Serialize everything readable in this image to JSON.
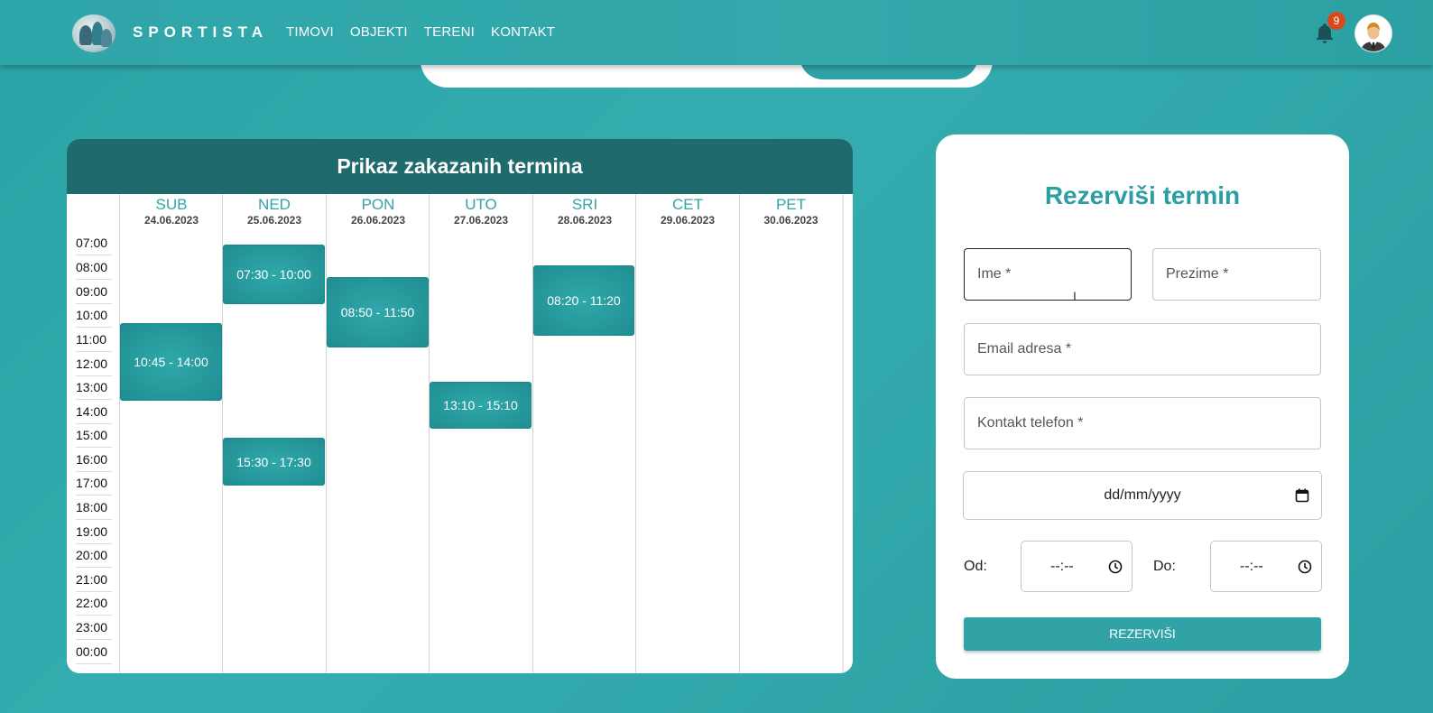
{
  "brand": {
    "name": "SPORTISTA"
  },
  "nav": {
    "items": [
      "TIMOVI",
      "OBJEKTI",
      "TERENI",
      "KONTAKT"
    ]
  },
  "notifications": {
    "count": "9"
  },
  "schedule": {
    "title": "Prikaz zakazanih termina",
    "days": [
      {
        "name": "SUB",
        "date": "24.06.2023"
      },
      {
        "name": "NED",
        "date": "25.06.2023"
      },
      {
        "name": "PON",
        "date": "26.06.2023"
      },
      {
        "name": "UTO",
        "date": "27.06.2023"
      },
      {
        "name": "SRI",
        "date": "28.06.2023"
      },
      {
        "name": "CET",
        "date": "29.06.2023"
      },
      {
        "name": "PET",
        "date": "30.06.2023"
      }
    ],
    "times": [
      "07:00",
      "08:00",
      "09:00",
      "10:00",
      "11:00",
      "12:00",
      "13:00",
      "14:00",
      "15:00",
      "16:00",
      "17:00",
      "18:00",
      "19:00",
      "20:00",
      "21:00",
      "22:00",
      "23:00",
      "00:00"
    ],
    "events": [
      {
        "label": "10:45 - 14:00",
        "day": "SUB"
      },
      {
        "label": "07:30 - 10:00",
        "day": "NED"
      },
      {
        "label": "15:30 - 17:30",
        "day": "NED"
      },
      {
        "label": "08:50 - 11:50",
        "day": "PON"
      },
      {
        "label": "13:10 - 15:10",
        "day": "UTO"
      },
      {
        "label": "08:20 - 11:20",
        "day": "SRI"
      }
    ]
  },
  "form": {
    "title": "Rezerviši termin",
    "first_name": "Ime *",
    "last_name": "Prezime *",
    "email": "Email adresa *",
    "phone": "Kontakt telefon *",
    "date": "dd/mm/yyyy",
    "from_label": "Od:",
    "to_label": "Do:",
    "from_time": "--:--",
    "to_time": "--:--",
    "submit": "REZERVIŠI"
  }
}
